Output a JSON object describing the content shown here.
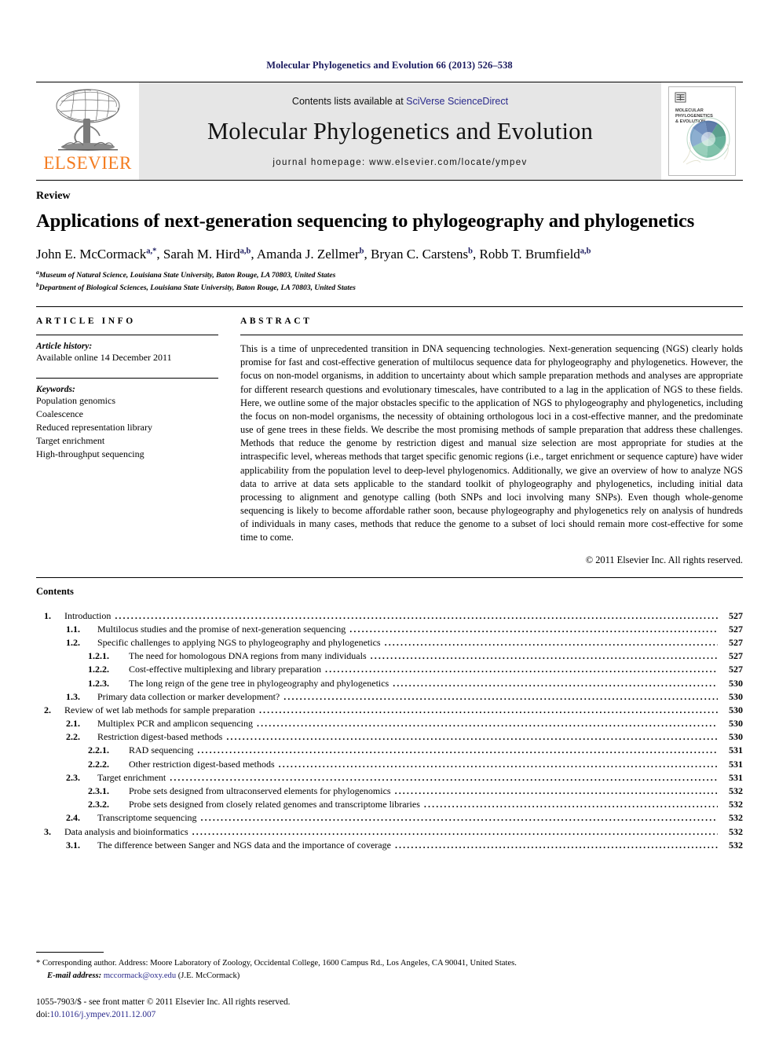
{
  "running_head": "Molecular Phylogenetics and Evolution 66 (2013) 526–538",
  "masthead": {
    "publisher_wordmark": "ELSEVIER",
    "contents_prefix": "Contents lists available at ",
    "contents_link": "SciVerse ScienceDirect",
    "journal_title": "Molecular Phylogenetics and Evolution",
    "homepage": "journal homepage: www.elsevier.com/locate/ympev",
    "cover_title_line1": "MOLECULAR",
    "cover_title_line2": "PHYLOGENETICS",
    "cover_title_line3": "& EVOLUTION"
  },
  "article": {
    "doctype": "Review",
    "title": "Applications of next-generation sequencing to phylogeography and phylogenetics",
    "authors": [
      {
        "name": "John E. McCormack",
        "marks": "a,*",
        "sep": ", "
      },
      {
        "name": "Sarah M. Hird",
        "marks": "a,b",
        "sep": ", "
      },
      {
        "name": "Amanda J. Zellmer",
        "marks": "b",
        "sep": ", "
      },
      {
        "name": "Bryan C. Carstens",
        "marks": "b",
        "sep": ", "
      },
      {
        "name": "Robb T. Brumfield",
        "marks": "a,b",
        "sep": ""
      }
    ],
    "affiliations": [
      {
        "mark": "a",
        "text": "Museum of Natural Science, Louisiana State University, Baton Rouge, LA 70803, United States"
      },
      {
        "mark": "b",
        "text": "Department of Biological Sciences, Louisiana State University, Baton Rouge, LA 70803, United States"
      }
    ]
  },
  "article_info": {
    "heading": "ARTICLE INFO",
    "history_label": "Article history:",
    "history_value": "Available online 14 December 2011",
    "keywords_label": "Keywords:",
    "keywords": [
      "Population genomics",
      "Coalescence",
      "Reduced representation library",
      "Target enrichment",
      "High-throughput sequencing"
    ]
  },
  "abstract": {
    "heading": "ABSTRACT",
    "body": "This is a time of unprecedented transition in DNA sequencing technologies. Next-generation sequencing (NGS) clearly holds promise for fast and cost-effective generation of multilocus sequence data for phylogeography and phylogenetics. However, the focus on non-model organisms, in addition to uncertainty about which sample preparation methods and analyses are appropriate for different research questions and evolutionary timescales, have contributed to a lag in the application of NGS to these fields. Here, we outline some of the major obstacles specific to the application of NGS to phylogeography and phylogenetics, including the focus on non-model organisms, the necessity of obtaining orthologous loci in a cost-effective manner, and the predominate use of gene trees in these fields. We describe the most promising methods of sample preparation that address these challenges. Methods that reduce the genome by restriction digest and manual size selection are most appropriate for studies at the intraspecific level, whereas methods that target specific genomic regions (i.e., target enrichment or sequence capture) have wider applicability from the population level to deep-level phylogenomics. Additionally, we give an overview of how to analyze NGS data to arrive at data sets applicable to the standard toolkit of phylogeography and phylogenetics, including initial data processing to alignment and genotype calling (both SNPs and loci involving many SNPs). Even though whole-genome sequencing is likely to become affordable rather soon, because phylogeography and phylogenetics rely on analysis of hundreds of individuals in many cases, methods that reduce the genome to a subset of loci should remain more cost-effective for some time to come.",
    "copyright": "© 2011 Elsevier Inc. All rights reserved."
  },
  "contents": {
    "heading": "Contents",
    "entries": [
      {
        "level": 1,
        "num": "1.",
        "label": "Introduction",
        "page": "527"
      },
      {
        "level": 2,
        "num": "1.1.",
        "label": "Multilocus studies and the promise of next-generation sequencing",
        "page": "527"
      },
      {
        "level": 2,
        "num": "1.2.",
        "label": "Specific challenges to applying NGS to phylogeography and phylogenetics",
        "page": "527"
      },
      {
        "level": 3,
        "num": "1.2.1.",
        "label": "The need for homologous DNA regions from many individuals",
        "page": "527"
      },
      {
        "level": 3,
        "num": "1.2.2.",
        "label": "Cost-effective multiplexing and library preparation",
        "page": "527"
      },
      {
        "level": 3,
        "num": "1.2.3.",
        "label": "The long reign of the gene tree in phylogeography and phylogenetics",
        "page": "530"
      },
      {
        "level": 2,
        "num": "1.3.",
        "label": "Primary data collection or marker development?",
        "page": "530"
      },
      {
        "level": 1,
        "num": "2.",
        "label": "Review of wet lab methods for sample preparation",
        "page": "530"
      },
      {
        "level": 2,
        "num": "2.1.",
        "label": "Multiplex PCR and amplicon sequencing",
        "page": "530"
      },
      {
        "level": 2,
        "num": "2.2.",
        "label": "Restriction digest-based methods",
        "page": "530"
      },
      {
        "level": 3,
        "num": "2.2.1.",
        "label": "RAD sequencing",
        "page": "531"
      },
      {
        "level": 3,
        "num": "2.2.2.",
        "label": "Other restriction digest-based methods",
        "page": "531"
      },
      {
        "level": 2,
        "num": "2.3.",
        "label": "Target enrichment",
        "page": "531"
      },
      {
        "level": 3,
        "num": "2.3.1.",
        "label": "Probe sets designed from ultraconserved elements for phylogenomics",
        "page": "532"
      },
      {
        "level": 3,
        "num": "2.3.2.",
        "label": "Probe sets designed from closely related genomes and transcriptome libraries",
        "page": "532"
      },
      {
        "level": 2,
        "num": "2.4.",
        "label": "Transcriptome sequencing",
        "page": "532"
      },
      {
        "level": 1,
        "num": "3.",
        "label": "Data analysis and bioinformatics",
        "page": "532"
      },
      {
        "level": 2,
        "num": "3.1.",
        "label": "The difference between Sanger and NGS data and the importance of coverage",
        "page": "532"
      }
    ]
  },
  "footer": {
    "corresponding_marker": "*",
    "corresponding_text": "Corresponding author. Address: Moore Laboratory of Zoology, Occidental College, 1600 Campus Rd., Los Angeles, CA 90041, United States.",
    "email_label": "E-mail address:",
    "email_link": "mccormack@oxy.edu",
    "email_suffix": "(J.E. McCormack)",
    "imprint_line1": "1055-7903/$ - see front matter © 2011 Elsevier Inc. All rights reserved.",
    "doi_label": "doi:",
    "doi_value": "10.1016/j.ympev.2011.12.007"
  },
  "colors": {
    "elsevier_orange": "#F47C20",
    "link_navy": "#2a2a8c",
    "running_head_navy": "#1a1a5e",
    "banner_grey": "#e6e6e6"
  }
}
